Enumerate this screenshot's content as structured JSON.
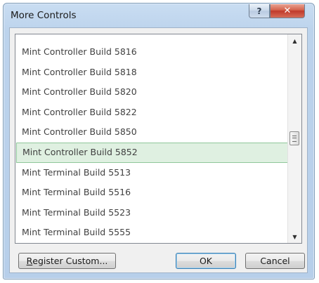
{
  "window": {
    "title": "More Controls",
    "help_glyph": "?",
    "close_glyph": "✕"
  },
  "list": {
    "selected_index": 5,
    "items": [
      "Mint Controller Build 5816",
      "Mint Controller Build 5818",
      "Mint Controller Build 5820",
      "Mint Controller Build 5822",
      "Mint Controller Build 5850",
      "Mint Controller Build 5852",
      "Mint Terminal Build 5513",
      "Mint Terminal Build 5516",
      "Mint Terminal Build 5523",
      "Mint Terminal Build 5555"
    ]
  },
  "scrollbar": {
    "up_glyph": "▲",
    "down_glyph": "▼"
  },
  "buttons": {
    "register_mnemonic": "R",
    "register_rest": "egister Custom...",
    "ok": "OK",
    "cancel": "Cancel"
  },
  "colors": {
    "selection_bg": "#dff0e1",
    "selection_border": "#8fc79a",
    "close_button": "#c0392b"
  }
}
